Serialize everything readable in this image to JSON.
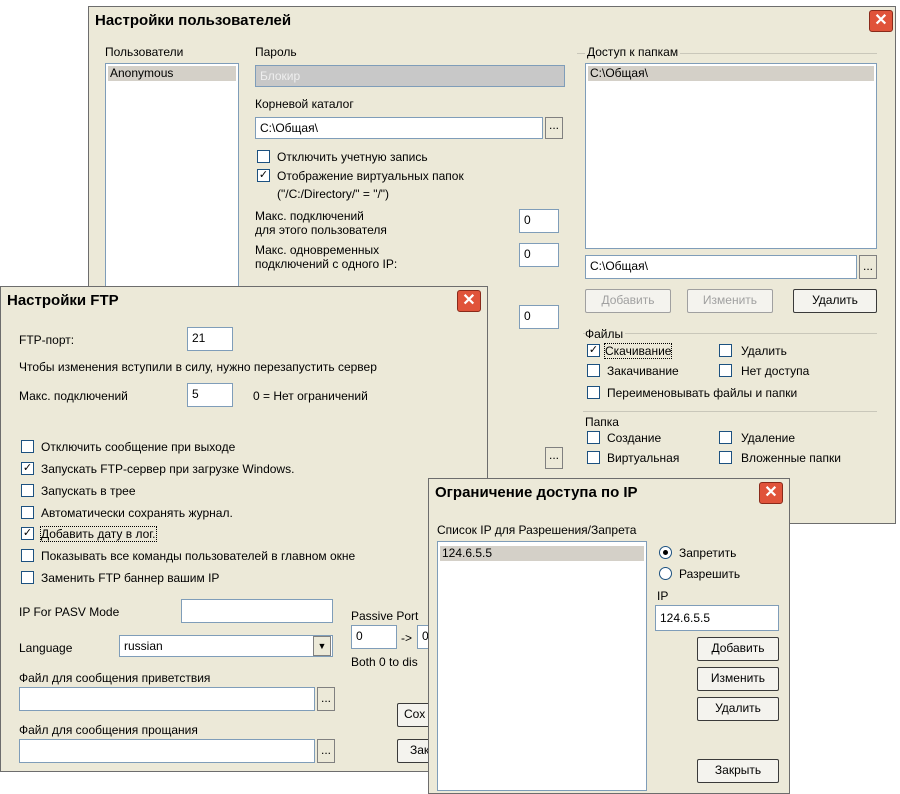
{
  "users_win": {
    "title": "Настройки пользователей",
    "close": "✕",
    "users_label": "Пользователи",
    "users": [
      "Anonymous"
    ],
    "password_label": "Пароль",
    "password_value": "Блокир",
    "root_label": "Корневой каталог",
    "root_value": "C:\\Общая\\",
    "browse": "...",
    "disable_account": "Отключить учетную запись",
    "virtual_dirs": "Отображение виртуальных папок",
    "virtual_dirs_hint": "(\"/C:/Directory/\" = \"/\")",
    "max_conn_user_l1": "Макс. подключений",
    "max_conn_user_l2": "для этого пользователя",
    "max_conn_user_value": "0",
    "max_conn_ip_l1": "Макс. одновременных",
    "max_conn_ip_l2": "подключений с одного IP:",
    "max_conn_ip_value": "0",
    "extra_value": "0",
    "folder_access_label": "Доступ к папкам",
    "folders": [
      "C:\\Общая\\"
    ],
    "folder_path": "C:\\Общая\\",
    "add_btn": "Добавить",
    "edit_btn": "Изменить",
    "delete_btn": "Удалить",
    "files_label": "Файлы",
    "f_download": "Скачивание",
    "f_delete": "Удалить",
    "f_upload": "Закачивание",
    "f_noaccess": "Нет доступа",
    "f_rename": "Переименовывать файлы и папки",
    "folder_label": "Папка",
    "d_create": "Создание",
    "d_delete": "Удаление",
    "d_virtual": "Виртуальная",
    "d_nested": "Вложенные папки",
    "check": "✓"
  },
  "ftp_win": {
    "title": "Настройки FTP",
    "close": "✕",
    "port_label": "FTP-порт:",
    "port_value": "21",
    "restart_note": "Чтобы изменения вступили в силу, нужно перезапустить сервер",
    "max_conn_label": "Макс. подключений",
    "max_conn_value": "5",
    "max_conn_note": "0 = Нет ограничений",
    "opt1": "Отключить сообщение при выходе",
    "opt2": "Запускать FTP-сервер при загрузке Windows.",
    "opt3": "Запускать в трее",
    "opt4": "Автоматически сохранять журнал.",
    "opt5": "Добавить дату в лог.",
    "opt6": "Показывать все команды пользователей в главном окне",
    "opt7": "Заменить FTP баннер вашим IP",
    "pasv_label": "IP For PASV Mode",
    "pasv_value": "",
    "passive_port_label": "Passive Port",
    "passive_from": "0",
    "passive_arrow": "->",
    "passive_to": "0",
    "passive_note": "Both 0 to dis",
    "language_label": "Language",
    "language_value": "russian",
    "welcome_label": "Файл для сообщения приветствия",
    "welcome_value": "",
    "goodbye_label": "Файл для сообщения прощания",
    "goodbye_value": "",
    "browse": "...",
    "save_btn": "Сох",
    "close_btn": "Зак",
    "check": "✓",
    "dropdown": "▼"
  },
  "ip_win": {
    "title": "Ограничение доступа по IP",
    "close": "✕",
    "list_label": "Список IP для Разрешения/Запрета",
    "ips": [
      "124.6.5.5"
    ],
    "deny": "Запретить",
    "allow": "Разрешить",
    "ip_label": "IP",
    "ip_value": "124.6.5.5",
    "add_btn": "Добавить",
    "edit_btn": "Изменить",
    "delete_btn": "Удалить",
    "close_btn": "Закрыть"
  }
}
